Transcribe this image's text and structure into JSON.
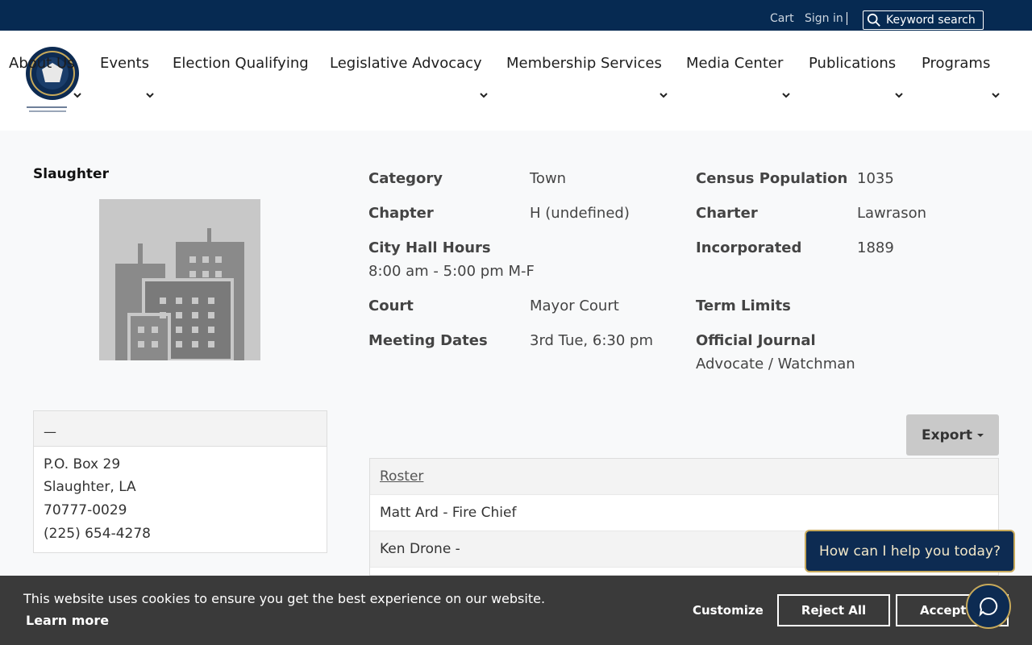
{
  "topbar": {
    "cart": "Cart",
    "signin": "Sign in",
    "search_label": "Keyword search"
  },
  "nav": {
    "items": [
      {
        "label": "About Us"
      },
      {
        "label": "Events"
      },
      {
        "label": "Election Qualifying"
      },
      {
        "label": "Legislative Advocacy"
      },
      {
        "label": "Membership Services"
      },
      {
        "label": "Media Center"
      },
      {
        "label": "Publications"
      },
      {
        "label": "Programs"
      }
    ]
  },
  "town": {
    "name": "Slaughter"
  },
  "details": {
    "category_label": "Category",
    "category": "Town",
    "chapter_label": "Chapter",
    "chapter": "H (undefined)",
    "cityhall_label": "City Hall Hours",
    "cityhall": "8:00 am - 5:00 pm M-F",
    "court_label": "Court",
    "court": "Mayor Court",
    "meeting_label": "Meeting Dates",
    "meeting": "3rd Tue, 6:30 pm",
    "census_label": "Census Population",
    "census": "1035",
    "charter_label": "Charter",
    "charter": "Lawrason",
    "incorporated_label": "Incorporated",
    "incorporated": "1889",
    "termlimits_label": "Term Limits",
    "journal_label": "Official Journal",
    "journal": "Advocate / Watchman"
  },
  "address": {
    "header": "—",
    "line1": "P.O. Box 29",
    "line2": "Slaughter, LA",
    "line3": "70777-0029",
    "phone": "(225) 654-4278"
  },
  "export_label": "Export",
  "roster": {
    "header": "Roster",
    "rows": [
      "Matt Ard - Fire Chief",
      "Ken Drone -"
    ]
  },
  "chat": {
    "prompt": "How can I help you today?"
  },
  "cookie": {
    "message": "This website uses cookies to ensure you get the best experience on our website.",
    "learn_more": "Learn more",
    "customize": "Customize",
    "reject": "Reject All",
    "accept": "Accept"
  },
  "colors": {
    "topbar": "#062a52",
    "chat_bg": "#0d2b52",
    "chat_border": "#c7a95a",
    "cookie_bg": "#3a3a3a"
  }
}
